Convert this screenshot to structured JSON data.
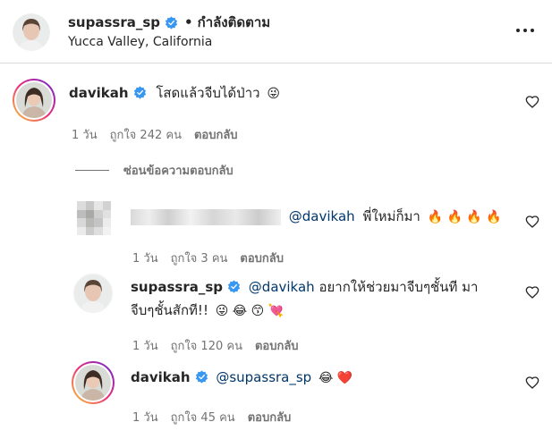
{
  "header": {
    "username": "supassra_sp",
    "separator": "•",
    "following_label": "กำลังติดตาม",
    "location": "Yucca Valley, California"
  },
  "comments": [
    {
      "username": "davikah",
      "text": "โสดแล้วจีบได้ป่าว",
      "emoji": "😜",
      "time": "1 วัน",
      "likes": "ถูกใจ 242 คน",
      "reply": "ตอบกลับ"
    }
  ],
  "hide_replies_label": "ซ่อนข้อความตอบกลับ",
  "replies": [
    {
      "username": "",
      "mention": "@davikah",
      "text": "พี่ใหม่ก็มา",
      "emoji": "🔥 🔥 🔥 🔥",
      "time": "1 วัน",
      "likes": "ถูกใจ 3 คน",
      "reply": "ตอบกลับ"
    },
    {
      "username": "supassra_sp",
      "mention": "@davikah",
      "text_line1": "อยากให้ช่วยมาจีบๆชั้นที มา",
      "text_line2": "จีบๆชั้นสักที!!",
      "emoji": "😜 😂 😙 💘",
      "time": "1 วัน",
      "likes": "ถูกใจ 120 คน",
      "reply": "ตอบกลับ"
    },
    {
      "username": "davikah",
      "mention": "@supassra_sp",
      "text": "",
      "emoji": "😂 ❤️",
      "time": "1 วัน",
      "likes": "ถูกใจ 45 คน",
      "reply": "ตอบกลับ"
    }
  ],
  "colors": {
    "verified": "#3897f0",
    "mention": "#00376b",
    "muted": "#737373",
    "divider": "#dbdbdb"
  },
  "icons": [
    "verified-badge-icon",
    "more-options-icon",
    "heart-icon"
  ]
}
